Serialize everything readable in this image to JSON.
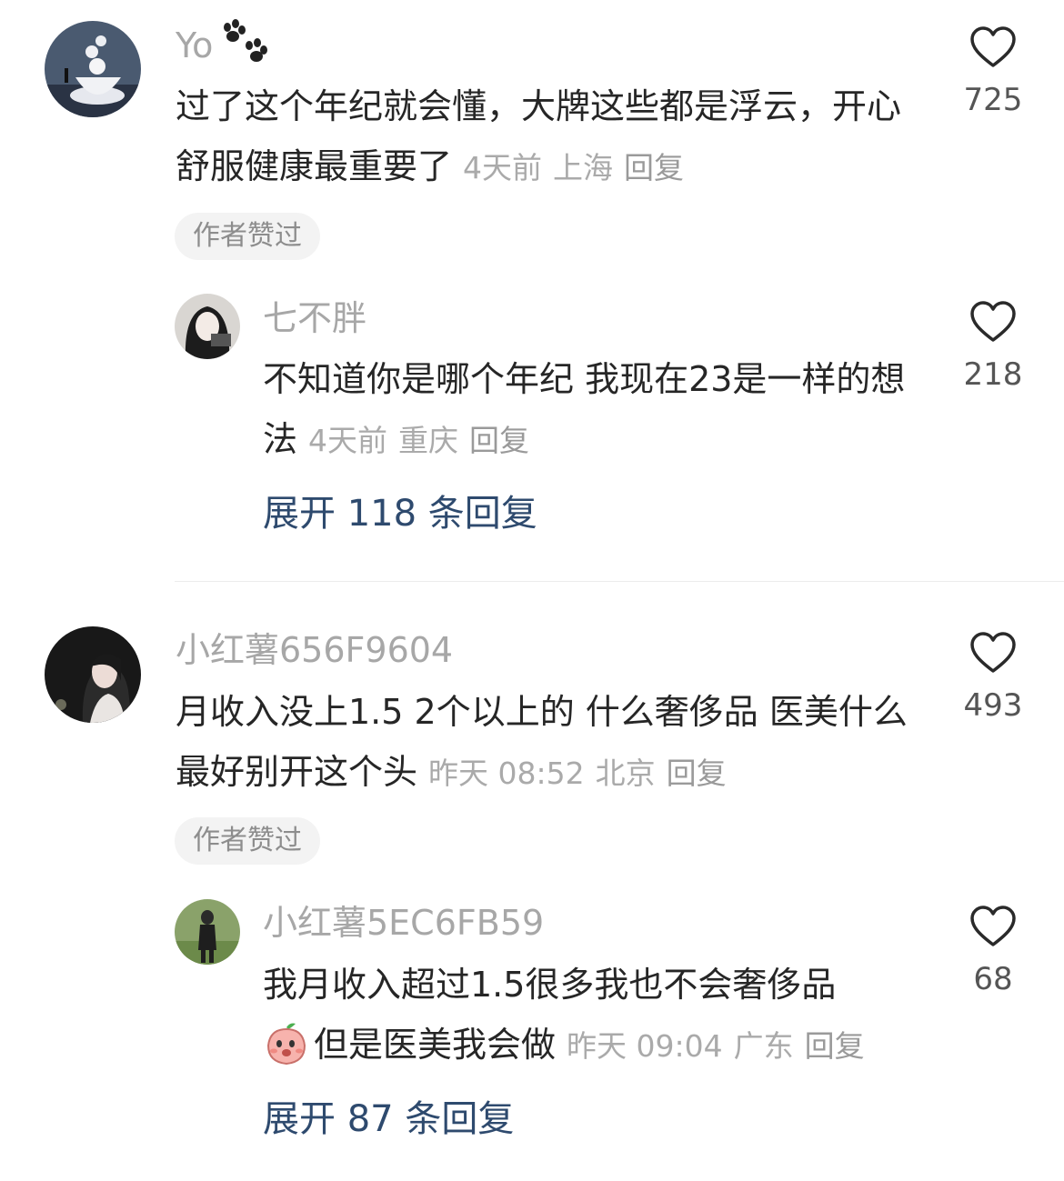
{
  "comments": [
    {
      "username": "Yo",
      "text": "过了这个年纪就会懂，大牌这些都是浮云，开心舒服健康最重要了",
      "time": "4天前",
      "location": "上海",
      "reply_label": "回复",
      "author_liked": "作者赞过",
      "likes": "725",
      "reply": {
        "username": "七不胖",
        "text": "不知道你是哪个年纪 我现在23是一样的想法",
        "time": "4天前",
        "location": "重庆",
        "reply_label": "回复",
        "likes": "218"
      },
      "expand": "展开 118 条回复"
    },
    {
      "username": "小红薯656F9604",
      "text": "月收入没上1.5  2个以上的  什么奢侈品  医美什么最好别开这个头",
      "time": "昨天 08:52",
      "location": "北京",
      "reply_label": "回复",
      "author_liked": "作者赞过",
      "likes": "493",
      "reply": {
        "username": "小红薯5EC6FB59",
        "text": "我月收入超过1.5很多我也不会奢侈品",
        "text2": "但是医美我会做",
        "time": "昨天 09:04",
        "location": "广东",
        "reply_label": "回复",
        "likes": "68"
      },
      "expand": "展开 87 条回复"
    }
  ],
  "colors": {
    "username": "#a7a7a7",
    "body_text": "#262626",
    "expand_link": "#2e4a6e",
    "meta": "#aaaaaa"
  }
}
